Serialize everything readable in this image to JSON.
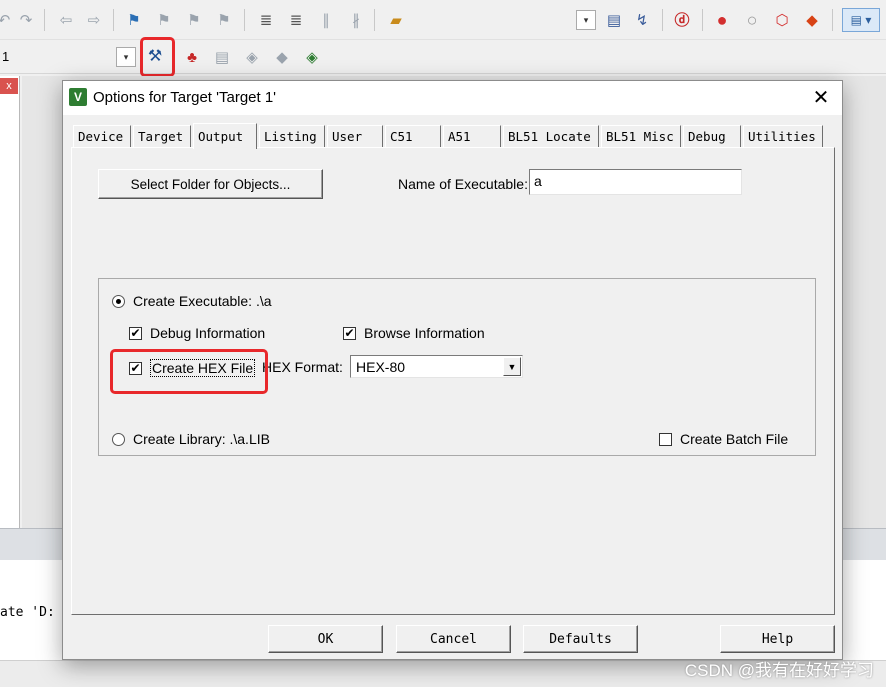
{
  "ide": {
    "toolbar1_icons": [
      "redo-icon",
      "back-icon",
      "forward-icon",
      "bookmark-icon",
      "prev-bookmark-icon",
      "next-bookmark-icon",
      "clear-bookmarks-icon",
      "indent-icon",
      "unindent-icon",
      "comment-icon",
      "uncomment-icon",
      "find-in-files-icon",
      "dropdown-icon",
      "find-icon",
      "debug-session-icon",
      "breakpoint-icon",
      "disabled-breakpoint-icon",
      "kill-breakpoints-icon",
      "window-layout-icon"
    ],
    "target_selector": "1",
    "toolbar2_icons": [
      "options-for-target-icon",
      "manage-project-icon",
      "manage-books-icon",
      "select-device-icon",
      "pack-installer-icon",
      "multi-project-icon"
    ],
    "output_text": "ate 'D:"
  },
  "dialog": {
    "title": "Options for Target 'Target 1'",
    "tabs": [
      "Device",
      "Target",
      "Output",
      "Listing",
      "User",
      "C51",
      "A51",
      "BL51 Locate",
      "BL51 Misc",
      "Debug",
      "Utilities"
    ],
    "active_tab": "Output",
    "select_folder_label": "Select Folder for Objects...",
    "name_of_executable_label": "Name of Executable:",
    "name_of_executable_value": "a",
    "create_executable_label": "Create Executable:  .\\a",
    "create_executable_selected": true,
    "debug_information_label": "Debug Information",
    "debug_information_checked": true,
    "browse_information_label": "Browse Information",
    "browse_information_checked": true,
    "create_hex_label": "Create HEX File",
    "create_hex_checked": true,
    "hex_format_label": "HEX Format:",
    "hex_format_value": "HEX-80",
    "create_library_label": "Create Library:  .\\a.LIB",
    "create_library_selected": false,
    "create_batch_label": "Create Batch File",
    "create_batch_checked": false,
    "ok_label": "OK",
    "cancel_label": "Cancel",
    "defaults_label": "Defaults",
    "help_label": "Help",
    "check_mark": "✔"
  },
  "watermark": "CSDN @我有在好好学习",
  "colors": {
    "highlight_box": "#e8282b",
    "title_logo": "#2e7d32"
  }
}
